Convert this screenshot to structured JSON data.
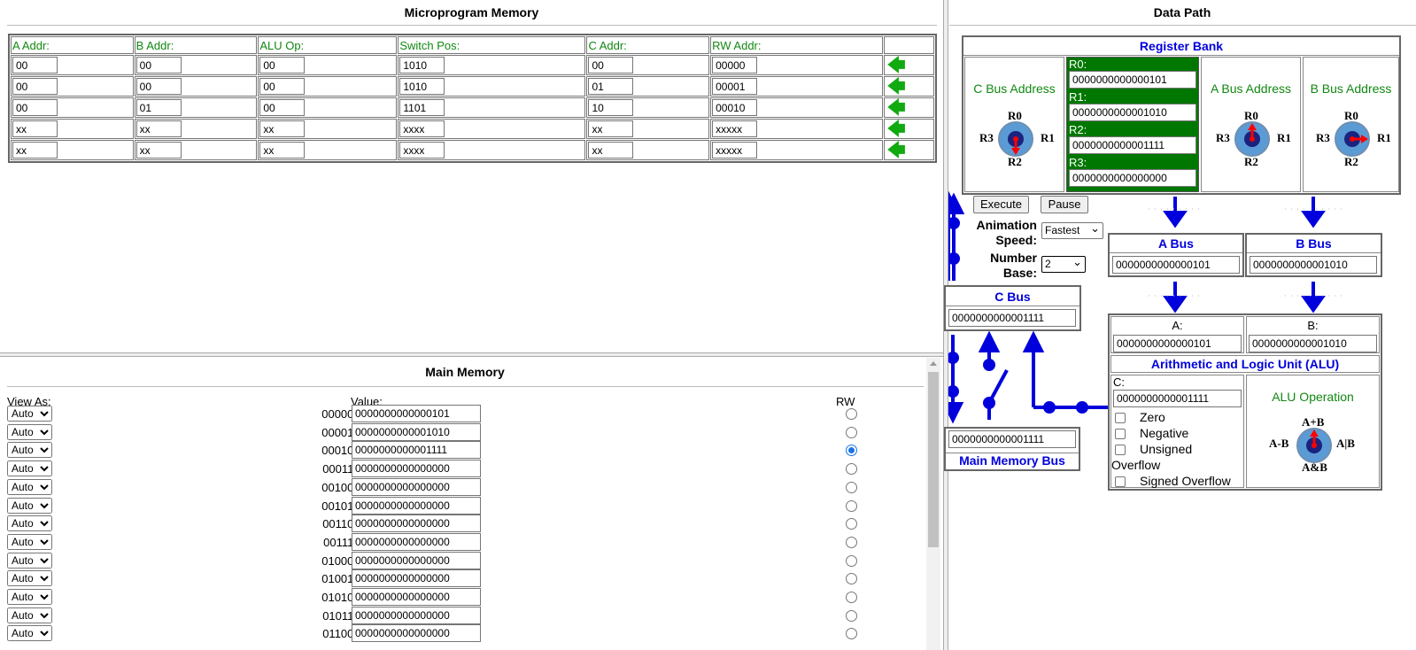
{
  "micro": {
    "title": "Microprogram Memory",
    "headers": [
      "A Addr:",
      "B Addr:",
      "ALU Op:",
      "Switch Pos:",
      "C Addr:",
      "RW Addr:"
    ],
    "rows": [
      [
        "00",
        "00",
        "00",
        "1010",
        "00",
        "00000"
      ],
      [
        "00",
        "00",
        "00",
        "1010",
        "01",
        "00001"
      ],
      [
        "00",
        "01",
        "00",
        "1101",
        "10",
        "00010"
      ],
      [
        "xx",
        "xx",
        "xx",
        "xxxx",
        "xx",
        "xxxxx"
      ],
      [
        "xx",
        "xx",
        "xx",
        "xxxx",
        "xx",
        "xxxxx"
      ]
    ],
    "arrow_glyph": "🡄",
    "arrow_color": "#11aa11"
  },
  "main": {
    "title": "Main Memory",
    "col_view": "View As:",
    "col_value": "Value:",
    "col_rw": "RW",
    "view_option": "Auto",
    "rows": [
      {
        "addr": "00000:",
        "value": "0000000000000101",
        "rw": false
      },
      {
        "addr": "00001:",
        "value": "0000000000001010",
        "rw": false
      },
      {
        "addr": "00010:",
        "value": "0000000000001111",
        "rw": true
      },
      {
        "addr": "00011:",
        "value": "0000000000000000",
        "rw": false
      },
      {
        "addr": "00100:",
        "value": "0000000000000000",
        "rw": false
      },
      {
        "addr": "00101:",
        "value": "0000000000000000",
        "rw": false
      },
      {
        "addr": "00110:",
        "value": "0000000000000000",
        "rw": false
      },
      {
        "addr": "00111:",
        "value": "0000000000000000",
        "rw": false
      },
      {
        "addr": "01000:",
        "value": "0000000000000000",
        "rw": false
      },
      {
        "addr": "01001:",
        "value": "0000000000000000",
        "rw": false
      },
      {
        "addr": "01010:",
        "value": "0000000000000000",
        "rw": false
      },
      {
        "addr": "01011:",
        "value": "0000000000000000",
        "rw": false
      },
      {
        "addr": "01100:",
        "value": "0000000000000000",
        "rw": false
      }
    ]
  },
  "datapath": {
    "title": "Data Path",
    "register_bank": "Register Bank",
    "c_bus_address": "C Bus Address",
    "a_bus_address": "A Bus Address",
    "b_bus_address": "B Bus Address",
    "registers": [
      {
        "label": "R0:",
        "value": "0000000000000101"
      },
      {
        "label": "R1:",
        "value": "0000000000001010"
      },
      {
        "label": "R2:",
        "value": "0000000000001111"
      },
      {
        "label": "R3:",
        "value": "0000000000000000"
      }
    ],
    "dial_labels": {
      "top": "R0",
      "right": "R1",
      "bottom": "R2",
      "left": "R3"
    },
    "execute_label": "Execute",
    "pause_label": "Pause",
    "speed_label_1": "Animation",
    "speed_label_2": "Speed:",
    "speed_value": "Fastest",
    "base_label_1": "Number",
    "base_label_2": "Base:",
    "base_value": "2",
    "a_bus": {
      "title": "A Bus",
      "value": "0000000000000101"
    },
    "b_bus": {
      "title": "B Bus",
      "value": "0000000000001010"
    },
    "c_bus": {
      "title": "C Bus",
      "value": "0000000000001111"
    },
    "mem_bus": {
      "title": "Main Memory Bus",
      "value": "0000000000001111"
    },
    "alu": {
      "a_label": "A:",
      "a_value": "0000000000000101",
      "b_label": "B:",
      "b_value": "0000000000001010",
      "title": "Arithmetic and Logic Unit (ALU)",
      "c_label": "C:",
      "c_value": "0000000000001111",
      "flags": [
        "Zero",
        "Negative",
        "Unsigned"
      ],
      "overflow_label": "Overflow",
      "signed_overflow": "Signed Overflow",
      "op_label": "ALU Operation",
      "op_top": "A+B",
      "op_left": "A-B",
      "op_right": "A|B",
      "op_bottom": "A&B"
    },
    "colors": {
      "bus": "#0000dd",
      "pointer": "#ff0000",
      "reg_bg": "#007700",
      "accent": "#118811"
    }
  }
}
